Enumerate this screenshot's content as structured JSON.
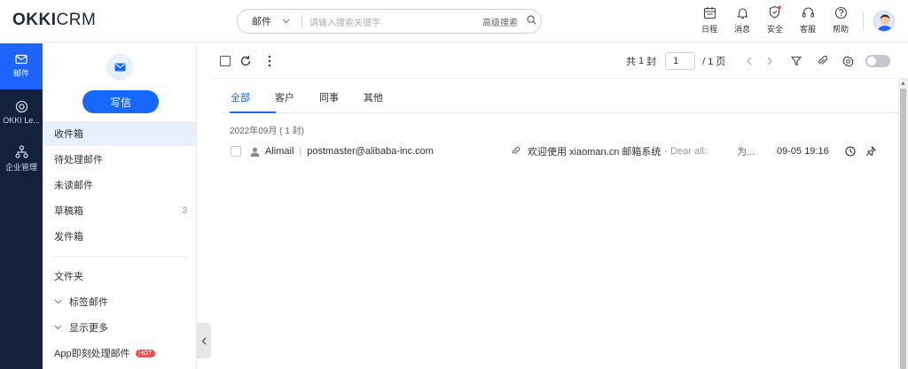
{
  "app": {
    "logo_text_a": "OKKI",
    "logo_text_b": "CRM"
  },
  "search": {
    "scope": "邮件",
    "placeholder": "请输入搜索关键字",
    "advanced": "高级搜索"
  },
  "top_tools": [
    {
      "label": "日程",
      "icon": "calendar-icon"
    },
    {
      "label": "消息",
      "icon": "bell-icon"
    },
    {
      "label": "安全",
      "icon": "shield-icon"
    },
    {
      "label": "客服",
      "icon": "headset-icon"
    },
    {
      "label": "帮助",
      "icon": "help-icon"
    }
  ],
  "left_nav": [
    {
      "label": "邮件",
      "icon": "mail-icon",
      "active": true
    },
    {
      "label": "OKKI Le...",
      "icon": "target-icon",
      "active": false
    },
    {
      "label": "企业管理",
      "icon": "org-icon",
      "active": false
    }
  ],
  "compose": {
    "label": "写信"
  },
  "folders": {
    "inbox": "收件箱",
    "pending": "待处理邮件",
    "unread": "未读邮件",
    "drafts": "草稿箱",
    "drafts_count": "3",
    "sent": "发件箱",
    "folder_header": "文件夹",
    "tagged": "标签邮件",
    "more": "显示更多",
    "app_process": "App即刻处理邮件",
    "hot_badge": "HOT"
  },
  "pager": {
    "total_prefix": "共",
    "total_count": "1",
    "total_suffix": "封",
    "page_current": "1",
    "page_total_label": "/ 1 页"
  },
  "tabs": [
    "全部",
    "客户",
    "同事",
    "其他"
  ],
  "mail_group": "2022年09月 ( 1 封)",
  "mails": [
    {
      "sender": "Alimail",
      "address": "postmaster@alibaba-inc.com",
      "subject": "欢迎使用 xiaoman.cn 邮箱系统",
      "preview": "- Dear all:",
      "truncated": "为...",
      "time": "09-05 19:16"
    }
  ],
  "colors": {
    "accent": "#1668ff",
    "nav_bg": "#14213d",
    "hot": "#ff4d4f"
  }
}
